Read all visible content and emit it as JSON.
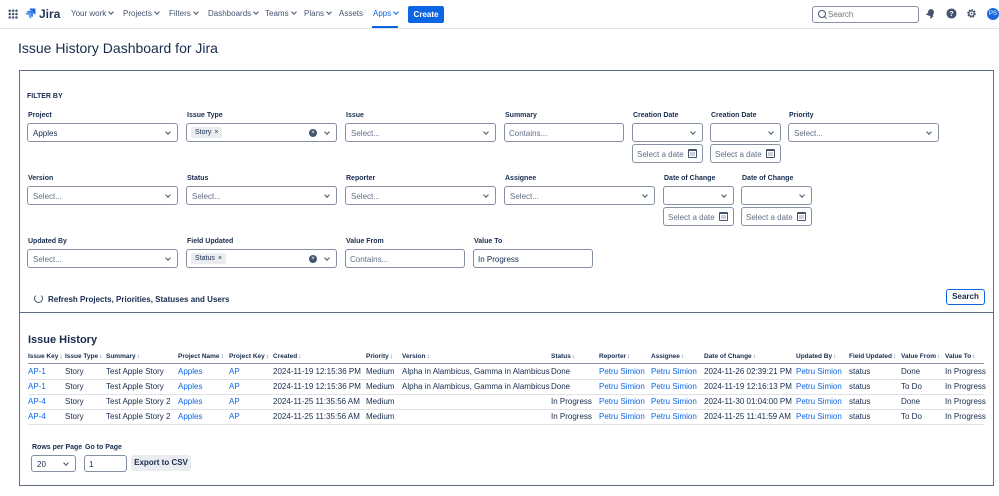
{
  "nav": {
    "logo": "Jira",
    "items": [
      "Your work",
      "Projects",
      "Filters",
      "Dashboards",
      "Teams",
      "Plans",
      "Assets",
      "Apps"
    ],
    "create_label": "Create",
    "search_placeholder": "Search",
    "avatar_initials": "PS"
  },
  "page": {
    "title": "Issue History Dashboard for Jira"
  },
  "filter": {
    "heading": "FILTER BY",
    "project": {
      "label": "Project",
      "value": "Apples"
    },
    "issue_type": {
      "label": "Issue Type",
      "chip": "Story"
    },
    "issue": {
      "label": "Issue",
      "placeholder": "Select..."
    },
    "summary": {
      "label": "Summary",
      "placeholder": "Contains..."
    },
    "creation_date_1": {
      "label": "Creation Date",
      "date_placeholder": "Select a date"
    },
    "creation_date_2": {
      "label": "Creation Date",
      "date_placeholder": "Select a date"
    },
    "priority": {
      "label": "Priority",
      "placeholder": "Select..."
    },
    "version": {
      "label": "Version",
      "placeholder": "Select..."
    },
    "status": {
      "label": "Status",
      "placeholder": "Select..."
    },
    "reporter": {
      "label": "Reporter",
      "placeholder": "Select..."
    },
    "assignee": {
      "label": "Assignee",
      "placeholder": "Select..."
    },
    "date_of_change_1": {
      "label": "Date of Change",
      "date_placeholder": "Select a date"
    },
    "date_of_change_2": {
      "label": "Date of Change",
      "date_placeholder": "Select a date"
    },
    "updated_by": {
      "label": "Updated By",
      "placeholder": "Select..."
    },
    "field_updated": {
      "label": "Field Updated",
      "chip": "Status"
    },
    "value_from": {
      "label": "Value From",
      "placeholder": "Contains..."
    },
    "value_to": {
      "label": "Value To",
      "value": "In Progress"
    },
    "refresh_label": "Refresh Projects, Priorities, Statuses and Users",
    "search_label": "Search"
  },
  "history": {
    "title": "Issue History",
    "columns": [
      "Issue Key",
      "Issue Type",
      "Summary",
      "Project Name",
      "Project Key",
      "Created",
      "Priority",
      "Version",
      "Status",
      "Reporter",
      "Assignee",
      "Date of Change",
      "Updated By",
      "Field Updated",
      "Value From",
      "Value To"
    ],
    "rows": [
      [
        "AP-1",
        "Story",
        "Test Apple Story",
        "Apples",
        "AP",
        "2024-11-19 12:15:36 PM",
        "Medium",
        "Alpha in Alambicus, Gamma in Alambicus",
        "Done",
        "Petru Simion",
        "Petru Simion",
        "2024-11-26 02:39:21 PM",
        "Petru Simion",
        "status",
        "Done",
        "In Progress"
      ],
      [
        "AP-1",
        "Story",
        "Test Apple Story",
        "Apples",
        "AP",
        "2024-11-19 12:15:36 PM",
        "Medium",
        "Alpha in Alambicus, Gamma in Alambicus",
        "Done",
        "Petru Simion",
        "Petru Simion",
        "2024-11-19 12:16:13 PM",
        "Petru Simion",
        "status",
        "To Do",
        "In Progress"
      ],
      [
        "AP-4",
        "Story",
        "Test Apple Story 2",
        "Apples",
        "AP",
        "2024-11-25 11:35:56 AM",
        "Medium",
        "",
        "In Progress",
        "Petru Simion",
        "Petru Simion",
        "2024-11-30 01:04:00 PM",
        "Petru Simion",
        "status",
        "Done",
        "In Progress"
      ],
      [
        "AP-4",
        "Story",
        "Test Apple Story 2",
        "Apples",
        "AP",
        "2024-11-25 11:35:56 AM",
        "Medium",
        "",
        "In Progress",
        "Petru Simion",
        "Petru Simion",
        "2024-11-25 11:41:59 AM",
        "Petru Simion",
        "status",
        "To Do",
        "In Progress"
      ]
    ]
  },
  "pagination": {
    "rows_per_page_label": "Rows per Page",
    "rows_per_page_value": "20",
    "go_to_page_label": "Go to Page",
    "go_to_page_value": "1",
    "export_label": "Export to CSV"
  },
  "colors": {
    "accent": "#0c66e4",
    "text": "#172b4d",
    "border": "#8590a2"
  }
}
